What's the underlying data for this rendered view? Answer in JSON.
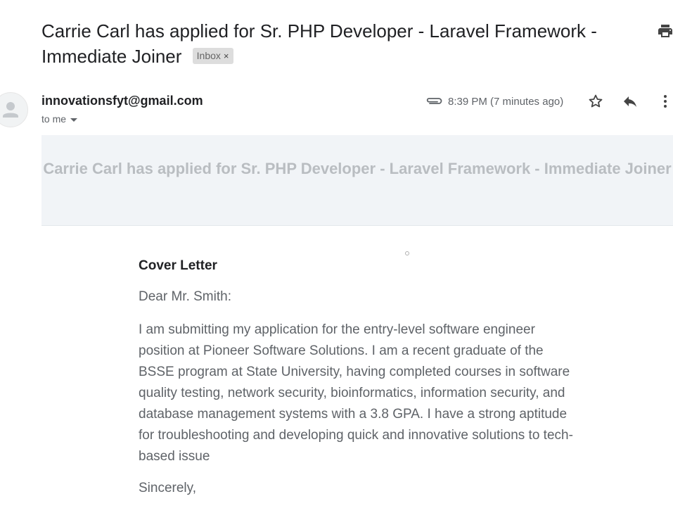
{
  "subject": {
    "title": "Carrie Carl has applied for Sr. PHP Developer - Laravel Framework - Immediate Joiner",
    "label_chip": "Inbox",
    "chip_remove": "×"
  },
  "sender": {
    "email": "innovationsfyt@gmail.com",
    "recipient": "to me",
    "timestamp": "8:39 PM (7 minutes ago)"
  },
  "icons": {
    "print": "print-icon",
    "avatar": "person-icon",
    "attachment": "paperclip-icon",
    "star": "star-icon",
    "reply": "reply-icon",
    "more": "more-vert-icon",
    "dropdown": "caret-down-icon"
  },
  "body": {
    "banner_title": "Carrie Carl has applied for Sr. PHP Developer - Laravel Framework - Immediate Joiner",
    "cover_title": "Cover Letter",
    "salutation": "Dear Mr. Smith:",
    "paragraph": "I am submitting my application for the entry-level software engineer position at Pioneer Software Solutions. I am a recent graduate of the BSSE program at State University, having completed courses in software quality testing, network security, bioinformatics, information security, and database management systems with a 3.8 GPA. I have a strong aptitude for troubleshooting and developing quick and innovative solutions to tech-based issue",
    "signoff": "Sincerely,"
  },
  "colors": {
    "text_primary": "#202124",
    "text_secondary": "#5f6368",
    "banner_bg": "#f1f4f7",
    "banner_text": "#b9bdc1",
    "chip_bg": "#dddddd"
  }
}
